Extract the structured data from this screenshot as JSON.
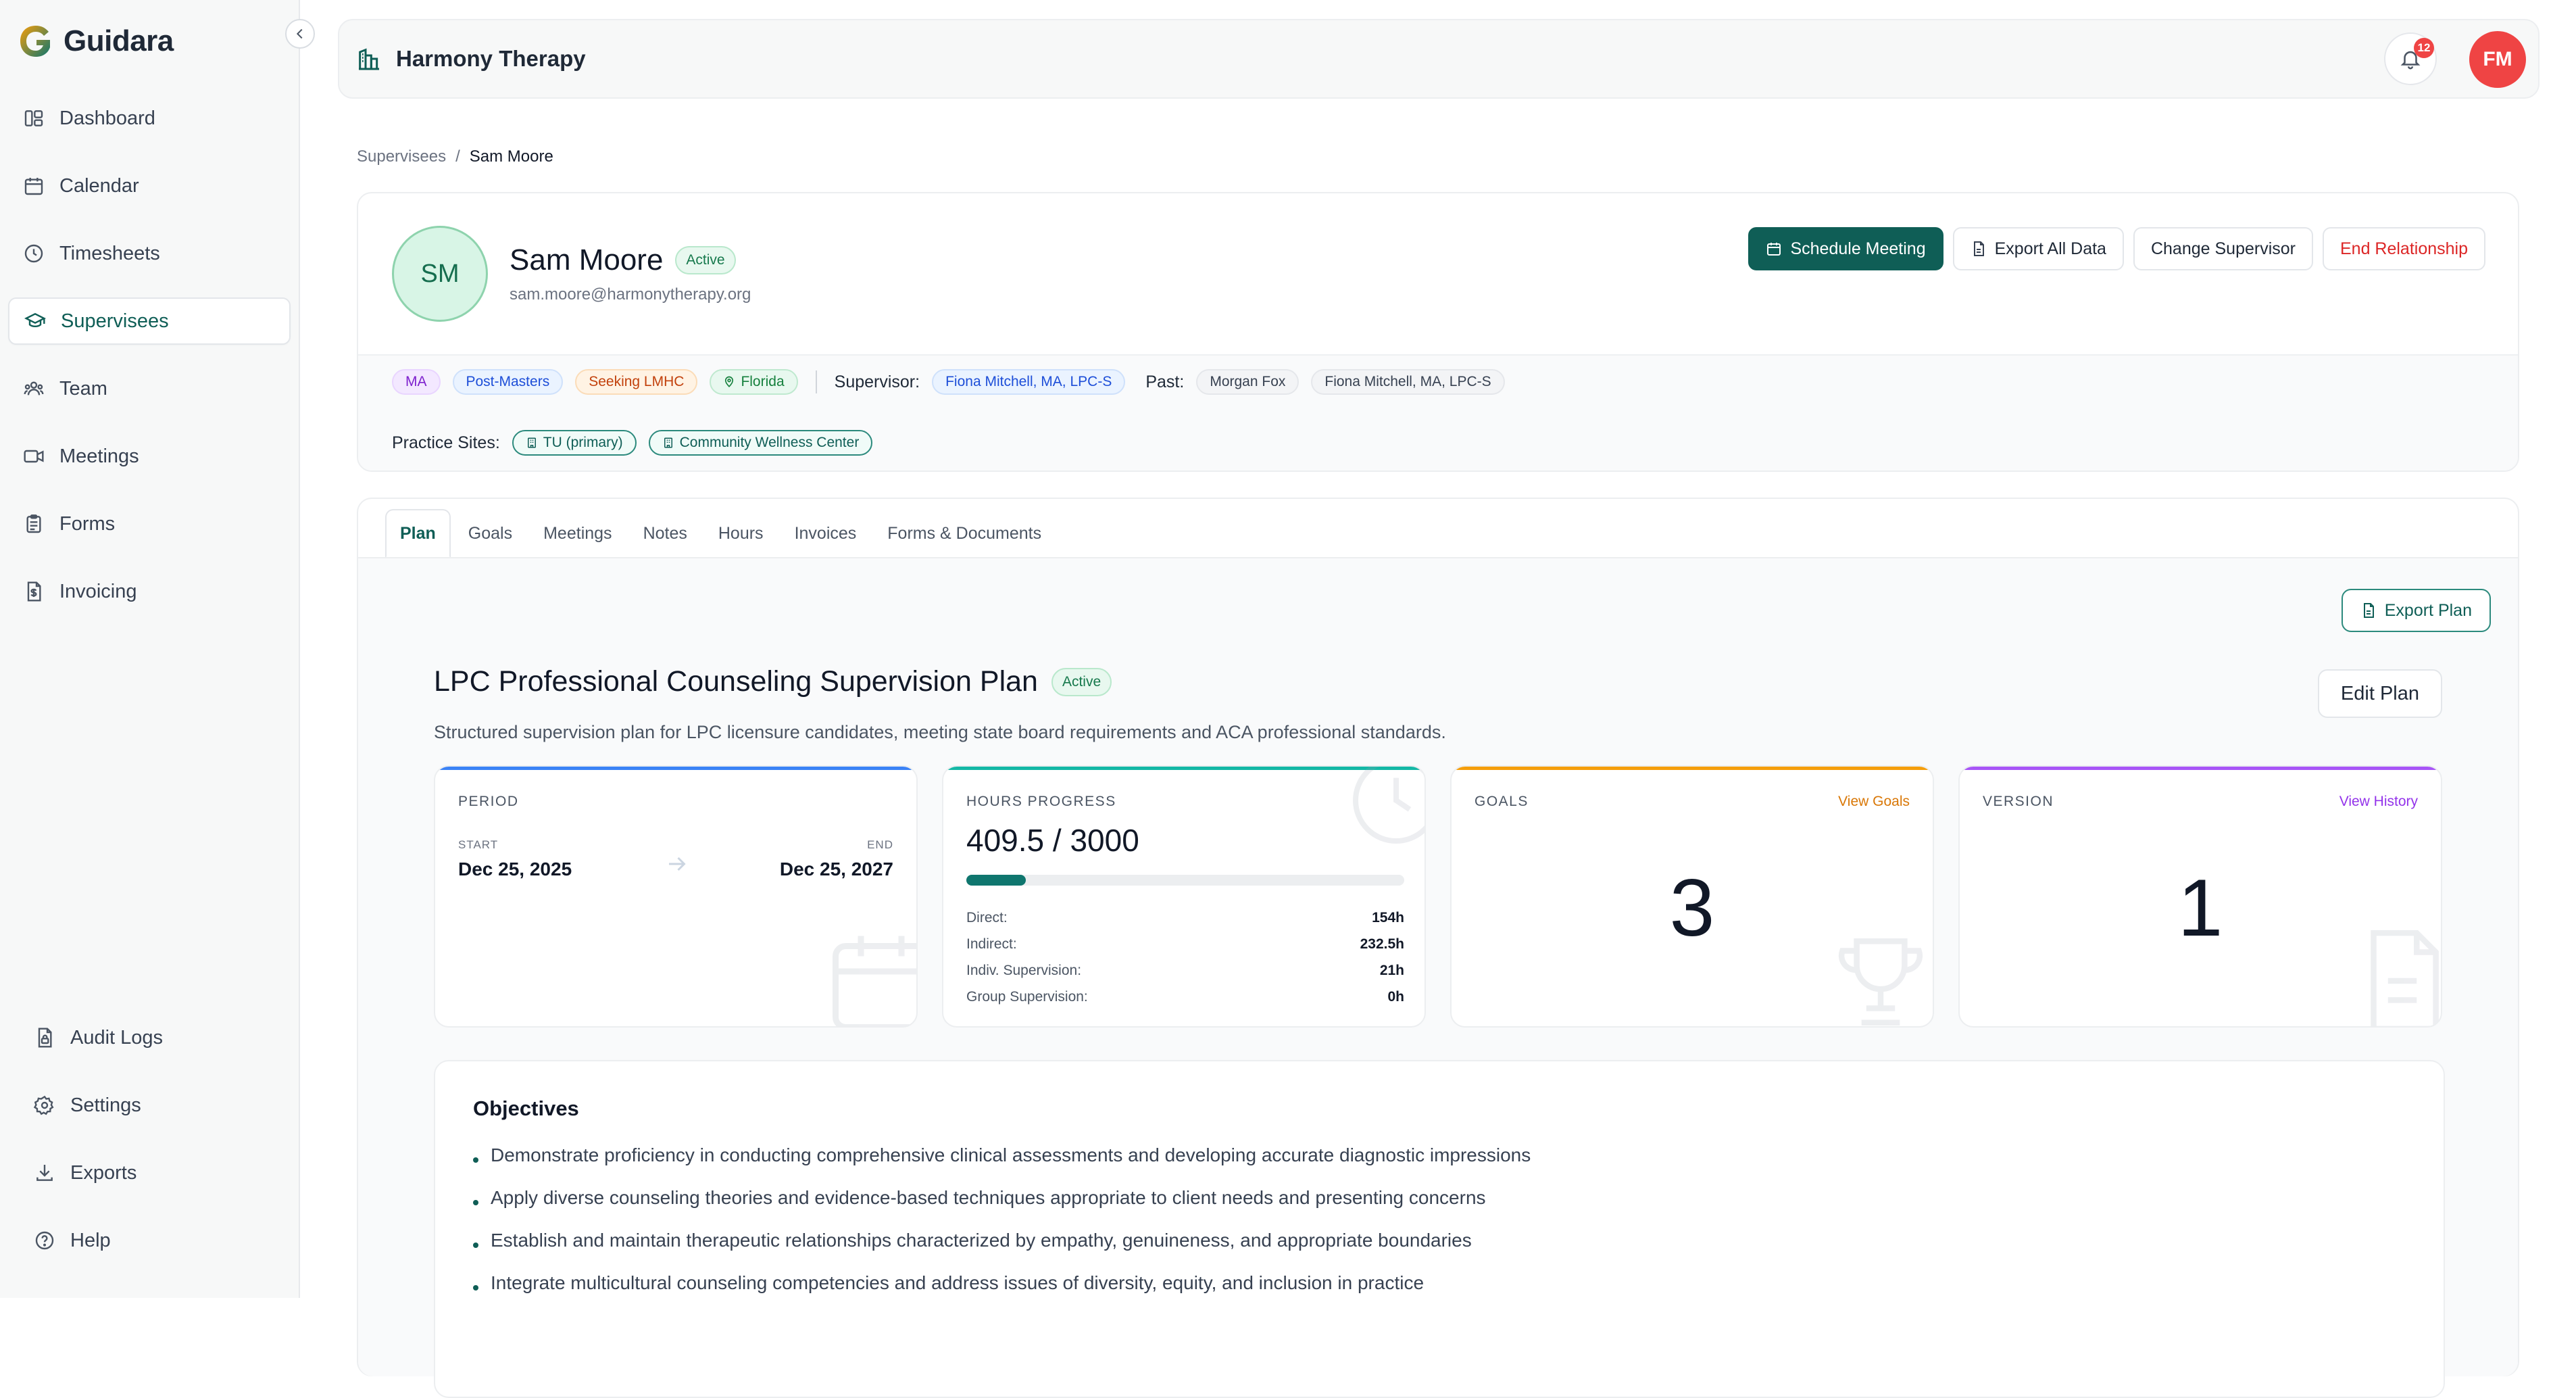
{
  "app": {
    "name": "Guidara"
  },
  "sidebar": {
    "items": [
      {
        "label": "Dashboard",
        "icon": "dashboard-icon"
      },
      {
        "label": "Calendar",
        "icon": "calendar-icon"
      },
      {
        "label": "Timesheets",
        "icon": "clock-icon"
      },
      {
        "label": "Supervisees",
        "icon": "graduation-cap-icon",
        "active": true
      },
      {
        "label": "Team",
        "icon": "team-icon"
      },
      {
        "label": "Meetings",
        "icon": "video-icon"
      },
      {
        "label": "Forms",
        "icon": "clipboard-icon"
      },
      {
        "label": "Invoicing",
        "icon": "invoice-icon"
      }
    ],
    "bottom_items": [
      {
        "label": "Audit Logs",
        "icon": "file-lock-icon"
      },
      {
        "label": "Settings",
        "icon": "gear-icon"
      },
      {
        "label": "Exports",
        "icon": "download-icon"
      },
      {
        "label": "Help",
        "icon": "help-circle-icon"
      }
    ]
  },
  "header": {
    "org_name": "Harmony Therapy",
    "notification_count": "12",
    "user_initials": "FM"
  },
  "breadcrumb": {
    "parent": "Supervisees",
    "separator": "/",
    "current": "Sam Moore"
  },
  "profile": {
    "initials": "SM",
    "name": "Sam Moore",
    "status": "Active",
    "email": "sam.moore@harmonytherapy.org",
    "actions": {
      "schedule": "Schedule Meeting",
      "export_all": "Export All Data",
      "change_supervisor": "Change Supervisor",
      "end_relationship": "End Relationship"
    },
    "tags": {
      "degree": "MA",
      "stage": "Post-Masters",
      "seeking": "Seeking LMHC",
      "state": "Florida"
    },
    "supervisor_label": "Supervisor:",
    "supervisor": "Fiona Mitchell, MA, LPC-S",
    "past_label": "Past:",
    "past": [
      "Morgan Fox",
      "Fiona Mitchell, MA, LPC-S"
    ],
    "practice_sites_label": "Practice Sites:",
    "practice_sites": [
      "TU (primary)",
      "Community Wellness Center"
    ]
  },
  "tabs": [
    "Plan",
    "Goals",
    "Meetings",
    "Notes",
    "Hours",
    "Invoices",
    "Forms & Documents"
  ],
  "plan": {
    "export_label": "Export Plan",
    "title": "LPC Professional Counseling Supervision Plan",
    "status": "Active",
    "description": "Structured supervision plan for LPC licensure candidates, meeting state board requirements and ACA professional standards.",
    "edit_label": "Edit Plan",
    "period": {
      "label": "PERIOD",
      "start_label": "START",
      "start": "Dec 25, 2025",
      "end_label": "END",
      "end": "Dec 25, 2027"
    },
    "hours": {
      "label": "HOURS PROGRESS",
      "value": "409.5 / 3000",
      "progress_fraction": 0.1365,
      "rows": [
        {
          "label": "Direct:",
          "value": "154h"
        },
        {
          "label": "Indirect:",
          "value": "232.5h"
        },
        {
          "label": "Indiv. Supervision:",
          "value": "21h"
        },
        {
          "label": "Group Supervision:",
          "value": "0h"
        }
      ]
    },
    "goals": {
      "label": "GOALS",
      "link": "View Goals",
      "value": "3"
    },
    "version": {
      "label": "VERSION",
      "link": "View History",
      "value": "1"
    },
    "objectives_title": "Objectives",
    "objectives": [
      "Demonstrate proficiency in conducting comprehensive clinical assessments and developing accurate diagnostic impressions",
      "Apply diverse counseling theories and evidence-based techniques appropriate to client needs and presenting concerns",
      "Establish and maintain therapeutic relationships characterized by empathy, genuineness, and appropriate boundaries",
      "Integrate multicultural counseling competencies and address issues of diversity, equity, and inclusion in practice"
    ]
  },
  "colors": {
    "brand": "#0f5e56",
    "period_accent": "#3b82f6",
    "hours_accent": "#14b8a6",
    "goals_accent": "#f59e0b",
    "version_accent": "#a855f7",
    "danger": "#dc2626"
  }
}
